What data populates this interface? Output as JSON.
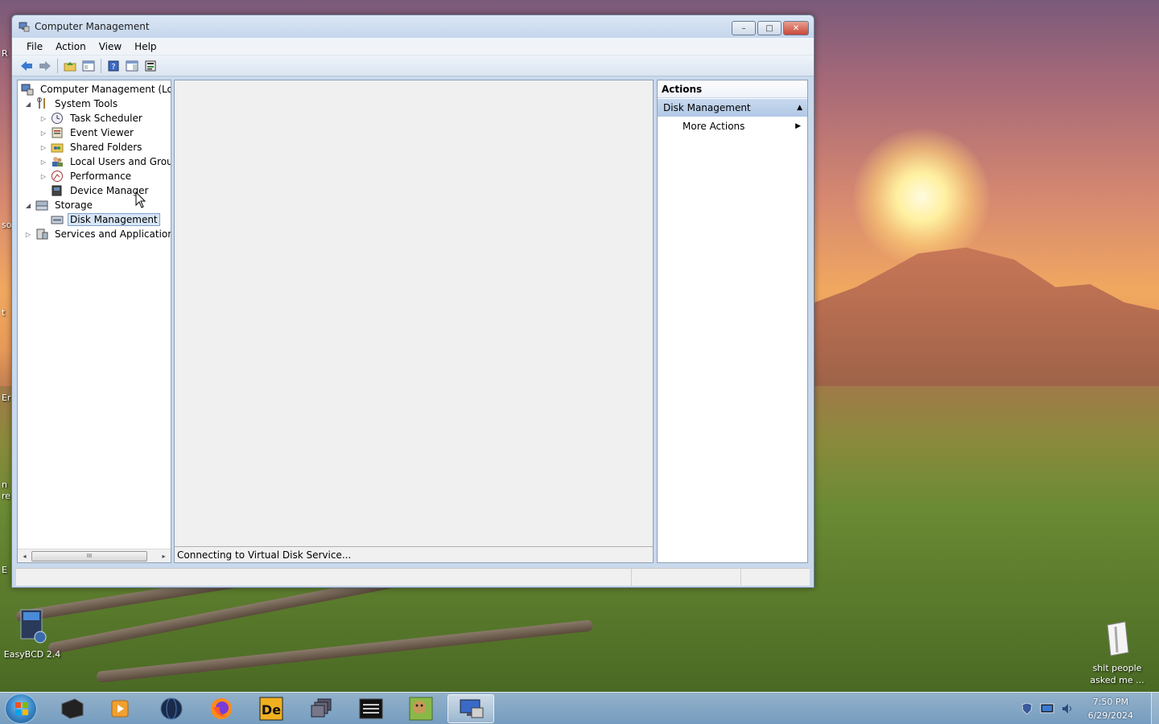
{
  "window": {
    "title": "Computer Management",
    "controls": {
      "minimize": "–",
      "maximize": "□",
      "close": "✕"
    }
  },
  "menubar": {
    "items": [
      "File",
      "Action",
      "View",
      "Help"
    ]
  },
  "toolbar": {
    "buttons": [
      "back-arrow-icon",
      "forward-arrow-icon",
      "up-folder-icon",
      "show-hide-console-tree-icon",
      "help-icon",
      "show-action-pane-icon",
      "properties-icon"
    ]
  },
  "tree": {
    "items": [
      {
        "label": "Computer Management (Local",
        "level": 0,
        "expander": "",
        "icon": "computer-management-icon"
      },
      {
        "label": "System Tools",
        "level": 1,
        "expander": "◢",
        "icon": "system-tools-icon"
      },
      {
        "label": "Task Scheduler",
        "level": 2,
        "expander": "▷",
        "icon": "task-scheduler-icon"
      },
      {
        "label": "Event Viewer",
        "level": 2,
        "expander": "▷",
        "icon": "event-viewer-icon"
      },
      {
        "label": "Shared Folders",
        "level": 2,
        "expander": "▷",
        "icon": "shared-folders-icon"
      },
      {
        "label": "Local Users and Groups",
        "level": 2,
        "expander": "▷",
        "icon": "local-users-icon"
      },
      {
        "label": "Performance",
        "level": 2,
        "expander": "▷",
        "icon": "performance-icon"
      },
      {
        "label": "Device Manager",
        "level": 2,
        "expander": "",
        "icon": "device-manager-icon"
      },
      {
        "label": "Storage",
        "level": 1,
        "expander": "◢",
        "icon": "storage-icon"
      },
      {
        "label": "Disk Management",
        "level": 2,
        "expander": "",
        "icon": "disk-management-icon",
        "selected": true
      },
      {
        "label": "Services and Applications",
        "level": 1,
        "expander": "▷",
        "icon": "services-applications-icon"
      }
    ],
    "scroll": {
      "left": "◂",
      "thumb": "III",
      "right": "▸"
    }
  },
  "center": {
    "status_text": "Connecting to Virtual Disk Service..."
  },
  "actions": {
    "header": "Actions",
    "section": "Disk Management",
    "section_arrow": "▲",
    "items": [
      {
        "label": "More Actions",
        "arrow": "▶"
      }
    ]
  },
  "desktop": {
    "icons": [
      {
        "label": "EasyBCD 2.4"
      },
      {
        "label": "shit people\nasked me ..."
      }
    ],
    "edge_text": [
      "R",
      "so",
      "t",
      "Er",
      "n",
      "re",
      "E"
    ]
  },
  "taskbar": {
    "apps": [
      "start-orb-icon",
      "terminal-app-icon",
      "media-player-icon",
      "browser-globe-icon",
      "firefox-icon",
      "de-app-icon",
      "windows-stack-icon",
      "console-app-icon",
      "box-app-icon",
      "computer-management-app-icon"
    ],
    "clock_time": "7:50 PM",
    "clock_date": "6/29/2024"
  },
  "colors": {
    "window_frame": "#c9d9ec",
    "selection": "#d8e6f6",
    "actions_section": "#b2c8e6"
  }
}
